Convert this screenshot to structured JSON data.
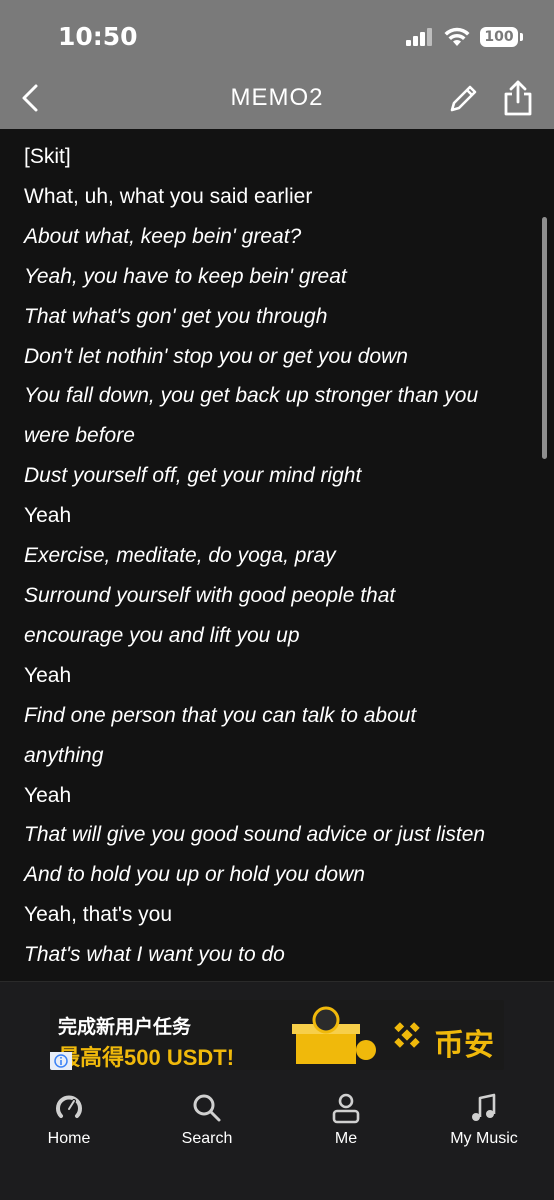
{
  "status_bar": {
    "time": "10:50",
    "battery": "100"
  },
  "nav": {
    "title": "MEMO2"
  },
  "lyrics": [
    {
      "text": "[Skit]",
      "italic": false
    },
    {
      "text": "What, uh, what you said earlier",
      "italic": false
    },
    {
      "text": "About what, keep bein' great?",
      "italic": true
    },
    {
      "text": "Yeah, you have to keep bein' great",
      "italic": true
    },
    {
      "text": "That what's gon' get you through",
      "italic": true
    },
    {
      "text": "Don't let nothin' stop you or get you down",
      "italic": true
    },
    {
      "text": "You fall down, you get back up stronger than you",
      "italic": true
    },
    {
      "text": "were before",
      "italic": true
    },
    {
      "text": "Dust yourself off, get your mind right",
      "italic": true
    },
    {
      "text": "Yeah",
      "italic": false
    },
    {
      "text": "Exercise, meditate, do yoga, pray",
      "italic": true
    },
    {
      "text": "Surround yourself with good people that",
      "italic": true
    },
    {
      "text": "encourage you and lift you up",
      "italic": true
    },
    {
      "text": "Yeah",
      "italic": false
    },
    {
      "text": "Find one person that you can talk to about",
      "italic": true
    },
    {
      "text": "anything",
      "italic": true
    },
    {
      "text": "Yeah",
      "italic": false
    },
    {
      "text": "That will give you good sound advice or just listen",
      "italic": true
    },
    {
      "text": "And to hold you up or hold you down",
      "italic": true
    },
    {
      "text": "Yeah, that's you",
      "italic": false
    },
    {
      "text": "That's what I want you to do",
      "italic": true
    }
  ],
  "ad": {
    "line1": "完成新用户任务",
    "line2": "最高得500 USDT!",
    "brand": "币安",
    "accent_color": "#f0b90b"
  },
  "tabs": [
    {
      "label": "Home",
      "icon": "home-dial-icon"
    },
    {
      "label": "Search",
      "icon": "search-icon"
    },
    {
      "label": "Me",
      "icon": "person-icon"
    },
    {
      "label": "My Music",
      "icon": "music-note-icon"
    }
  ]
}
